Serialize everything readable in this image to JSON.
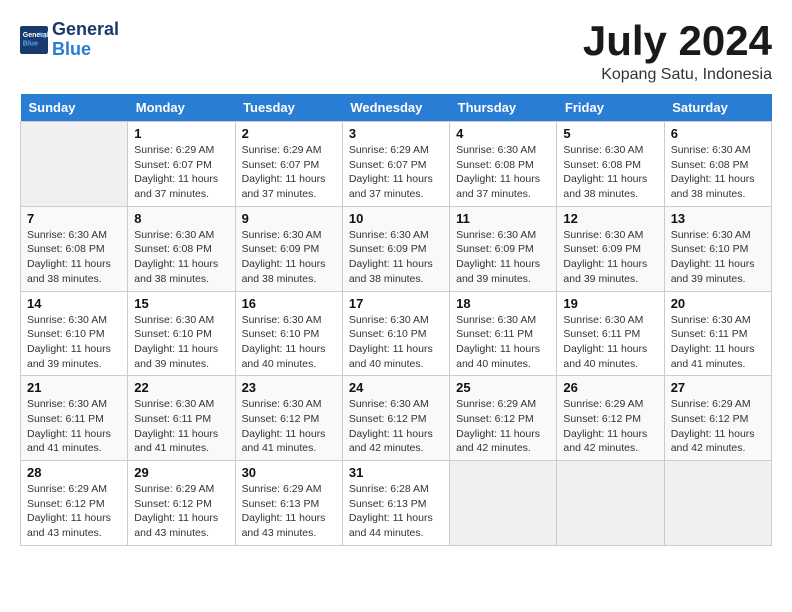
{
  "header": {
    "logo_line1": "General",
    "logo_line2": "Blue",
    "month_year": "July 2024",
    "location": "Kopang Satu, Indonesia"
  },
  "days_of_week": [
    "Sunday",
    "Monday",
    "Tuesday",
    "Wednesday",
    "Thursday",
    "Friday",
    "Saturday"
  ],
  "weeks": [
    [
      {
        "day": "",
        "info": ""
      },
      {
        "day": "1",
        "info": "Sunrise: 6:29 AM\nSunset: 6:07 PM\nDaylight: 11 hours and 37 minutes."
      },
      {
        "day": "2",
        "info": "Sunrise: 6:29 AM\nSunset: 6:07 PM\nDaylight: 11 hours and 37 minutes."
      },
      {
        "day": "3",
        "info": "Sunrise: 6:29 AM\nSunset: 6:07 PM\nDaylight: 11 hours and 37 minutes."
      },
      {
        "day": "4",
        "info": "Sunrise: 6:30 AM\nSunset: 6:08 PM\nDaylight: 11 hours and 37 minutes."
      },
      {
        "day": "5",
        "info": "Sunrise: 6:30 AM\nSunset: 6:08 PM\nDaylight: 11 hours and 38 minutes."
      },
      {
        "day": "6",
        "info": "Sunrise: 6:30 AM\nSunset: 6:08 PM\nDaylight: 11 hours and 38 minutes."
      }
    ],
    [
      {
        "day": "7",
        "info": "Sunrise: 6:30 AM\nSunset: 6:08 PM\nDaylight: 11 hours and 38 minutes."
      },
      {
        "day": "8",
        "info": "Sunrise: 6:30 AM\nSunset: 6:08 PM\nDaylight: 11 hours and 38 minutes."
      },
      {
        "day": "9",
        "info": "Sunrise: 6:30 AM\nSunset: 6:09 PM\nDaylight: 11 hours and 38 minutes."
      },
      {
        "day": "10",
        "info": "Sunrise: 6:30 AM\nSunset: 6:09 PM\nDaylight: 11 hours and 38 minutes."
      },
      {
        "day": "11",
        "info": "Sunrise: 6:30 AM\nSunset: 6:09 PM\nDaylight: 11 hours and 39 minutes."
      },
      {
        "day": "12",
        "info": "Sunrise: 6:30 AM\nSunset: 6:09 PM\nDaylight: 11 hours and 39 minutes."
      },
      {
        "day": "13",
        "info": "Sunrise: 6:30 AM\nSunset: 6:10 PM\nDaylight: 11 hours and 39 minutes."
      }
    ],
    [
      {
        "day": "14",
        "info": "Sunrise: 6:30 AM\nSunset: 6:10 PM\nDaylight: 11 hours and 39 minutes."
      },
      {
        "day": "15",
        "info": "Sunrise: 6:30 AM\nSunset: 6:10 PM\nDaylight: 11 hours and 39 minutes."
      },
      {
        "day": "16",
        "info": "Sunrise: 6:30 AM\nSunset: 6:10 PM\nDaylight: 11 hours and 40 minutes."
      },
      {
        "day": "17",
        "info": "Sunrise: 6:30 AM\nSunset: 6:10 PM\nDaylight: 11 hours and 40 minutes."
      },
      {
        "day": "18",
        "info": "Sunrise: 6:30 AM\nSunset: 6:11 PM\nDaylight: 11 hours and 40 minutes."
      },
      {
        "day": "19",
        "info": "Sunrise: 6:30 AM\nSunset: 6:11 PM\nDaylight: 11 hours and 40 minutes."
      },
      {
        "day": "20",
        "info": "Sunrise: 6:30 AM\nSunset: 6:11 PM\nDaylight: 11 hours and 41 minutes."
      }
    ],
    [
      {
        "day": "21",
        "info": "Sunrise: 6:30 AM\nSunset: 6:11 PM\nDaylight: 11 hours and 41 minutes."
      },
      {
        "day": "22",
        "info": "Sunrise: 6:30 AM\nSunset: 6:11 PM\nDaylight: 11 hours and 41 minutes."
      },
      {
        "day": "23",
        "info": "Sunrise: 6:30 AM\nSunset: 6:12 PM\nDaylight: 11 hours and 41 minutes."
      },
      {
        "day": "24",
        "info": "Sunrise: 6:30 AM\nSunset: 6:12 PM\nDaylight: 11 hours and 42 minutes."
      },
      {
        "day": "25",
        "info": "Sunrise: 6:29 AM\nSunset: 6:12 PM\nDaylight: 11 hours and 42 minutes."
      },
      {
        "day": "26",
        "info": "Sunrise: 6:29 AM\nSunset: 6:12 PM\nDaylight: 11 hours and 42 minutes."
      },
      {
        "day": "27",
        "info": "Sunrise: 6:29 AM\nSunset: 6:12 PM\nDaylight: 11 hours and 42 minutes."
      }
    ],
    [
      {
        "day": "28",
        "info": "Sunrise: 6:29 AM\nSunset: 6:12 PM\nDaylight: 11 hours and 43 minutes."
      },
      {
        "day": "29",
        "info": "Sunrise: 6:29 AM\nSunset: 6:12 PM\nDaylight: 11 hours and 43 minutes."
      },
      {
        "day": "30",
        "info": "Sunrise: 6:29 AM\nSunset: 6:13 PM\nDaylight: 11 hours and 43 minutes."
      },
      {
        "day": "31",
        "info": "Sunrise: 6:28 AM\nSunset: 6:13 PM\nDaylight: 11 hours and 44 minutes."
      },
      {
        "day": "",
        "info": ""
      },
      {
        "day": "",
        "info": ""
      },
      {
        "day": "",
        "info": ""
      }
    ]
  ]
}
